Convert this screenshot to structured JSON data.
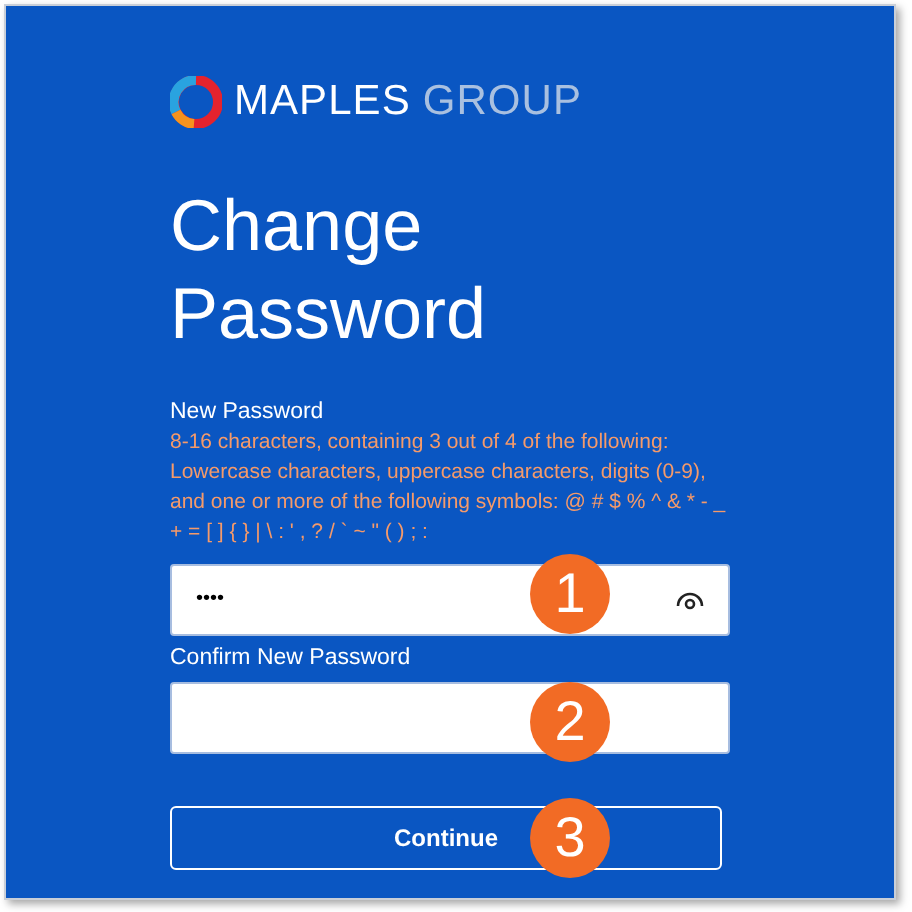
{
  "logo": {
    "brand": "MAPLES",
    "suffix": "GROUP"
  },
  "title": "Change Password",
  "new_password": {
    "label": "New Password",
    "hint": "8-16 characters, containing 3 out of 4 of the following: Lowercase characters, uppercase characters, digits (0-9), and one or more of the following symbols: @ # $ % ^ & * - _ + = [ ] { } | \\ : ' , ? / ` ~ \" ( ) ; :",
    "value": "••••",
    "badge": "1"
  },
  "confirm_password": {
    "label": "Confirm New Password",
    "badge": "2"
  },
  "continue_button": {
    "label": "Continue",
    "badge": "3"
  }
}
